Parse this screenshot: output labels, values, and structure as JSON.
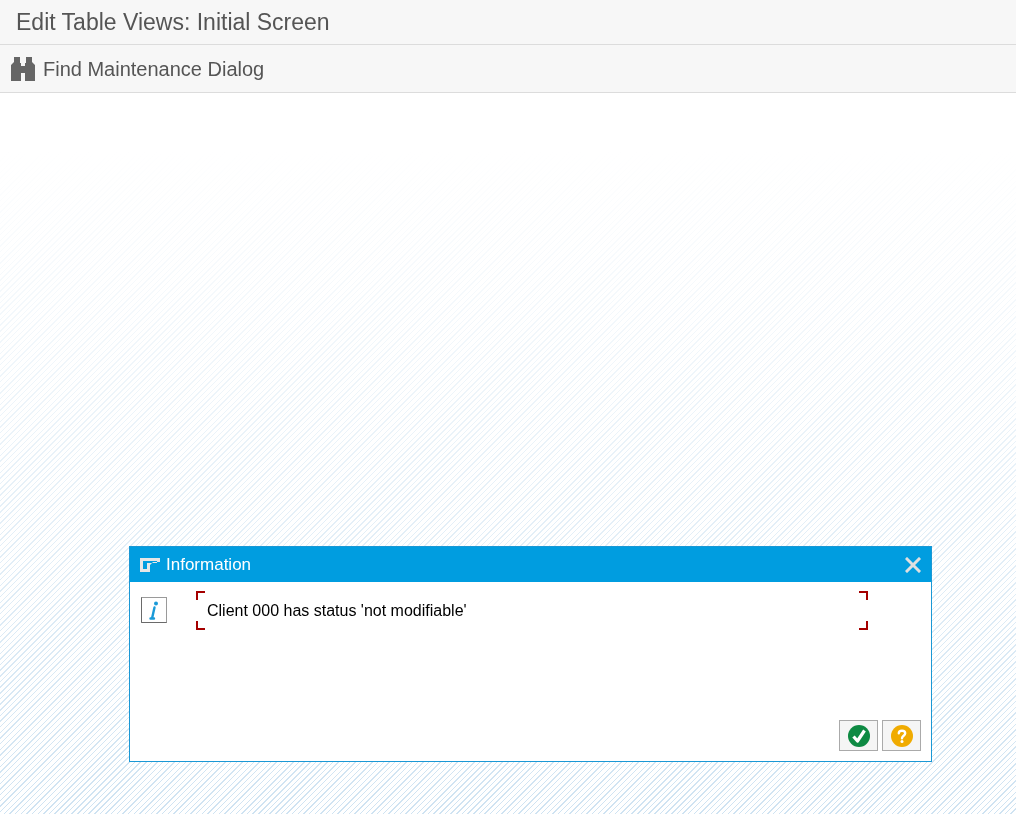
{
  "window": {
    "title": "Edit Table Views: Initial Screen"
  },
  "toolbar": {
    "buttons": [
      {
        "kind": "find",
        "label": "Find Maintenance Dialog"
      }
    ]
  },
  "dialog": {
    "title": "Information",
    "message": {
      "kind": "info",
      "text": "Client 000 has status 'not modifiable'",
      "focused": true
    },
    "buttons": [
      {
        "kind": "confirm"
      },
      {
        "kind": "help"
      }
    ]
  }
}
